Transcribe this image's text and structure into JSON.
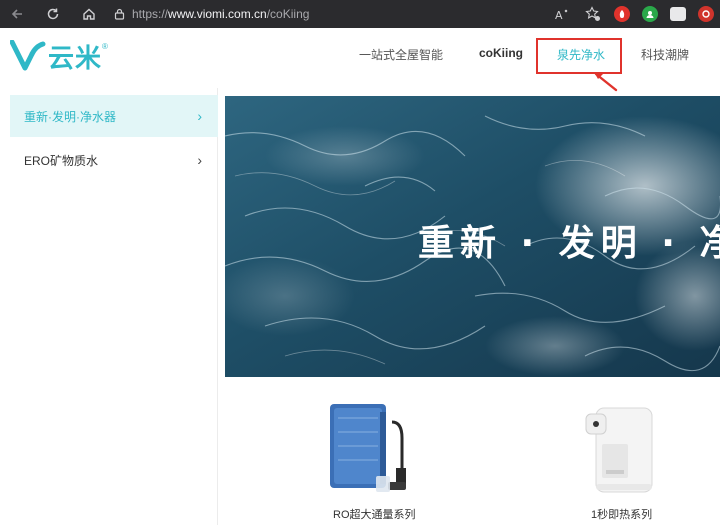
{
  "browser": {
    "url_scheme": "https://",
    "url_host": "www.viomi.com.cn",
    "url_path": "/coKiing"
  },
  "header": {
    "logo_text": "云米",
    "logo_reg": "®",
    "nav": [
      {
        "label": "一站式全屋智能"
      },
      {
        "label": "coKiing"
      },
      {
        "label": "泉先净水"
      },
      {
        "label": "科技潮牌"
      }
    ]
  },
  "sidebar": {
    "items": [
      {
        "label": "重新·发明·净水器"
      },
      {
        "label": "ERO矿物质水"
      }
    ]
  },
  "banner": {
    "headline": "重新 · 发明 · 净"
  },
  "products": [
    {
      "label": "RO超大通量系列"
    },
    {
      "label": "1秒即热系列"
    }
  ],
  "colors": {
    "brand": "#2fb8c7",
    "highlight": "#e0332c",
    "chrome": "#2b2b2e"
  }
}
